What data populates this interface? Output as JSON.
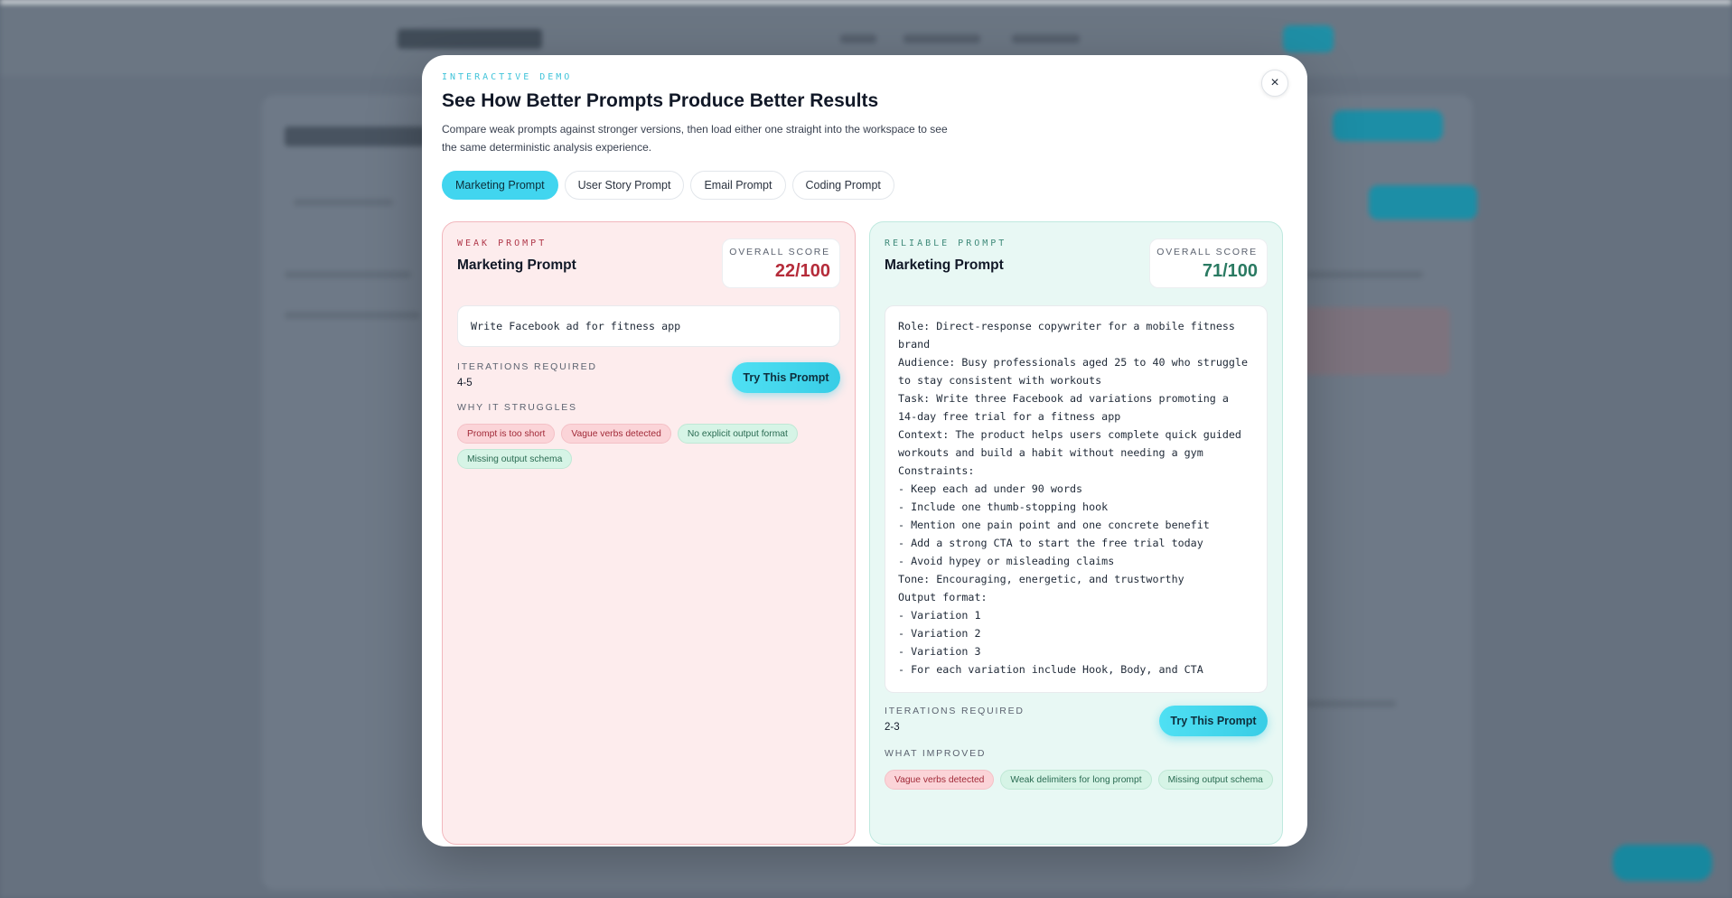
{
  "modal": {
    "eyebrow": "INTERACTIVE DEMO",
    "title": "See How Better Prompts Produce Better Results",
    "subtitle": "Compare weak prompts against stronger versions, then load either one straight into the workspace to see the same deterministic analysis experience.",
    "close_icon": "×"
  },
  "tabs": [
    {
      "label": "Marketing Prompt",
      "active": true
    },
    {
      "label": "User Story Prompt",
      "active": false
    },
    {
      "label": "Email Prompt",
      "active": false
    },
    {
      "label": "Coding Prompt",
      "active": false
    }
  ],
  "weak": {
    "eyebrow": "WEAK PROMPT",
    "title": "Marketing Prompt",
    "score_label": "OVERALL SCORE",
    "score": "22/100",
    "prompt": "Write Facebook ad for fitness app",
    "iterations_label": "ITERATIONS REQUIRED",
    "iterations": "4-5",
    "try_button": "Try This Prompt",
    "section_label": "WHY IT STRUGGLES",
    "chips": [
      {
        "text": "Prompt is too short",
        "tone": "negative"
      },
      {
        "text": "Vague verbs detected",
        "tone": "negative"
      },
      {
        "text": "No explicit output format",
        "tone": "positive"
      },
      {
        "text": "Missing output schema",
        "tone": "positive"
      }
    ]
  },
  "reliable": {
    "eyebrow": "RELIABLE PROMPT",
    "title": "Marketing Prompt",
    "score_label": "OVERALL SCORE",
    "score": "71/100",
    "prompt": "Role: Direct-response copywriter for a mobile fitness brand\nAudience: Busy professionals aged 25 to 40 who struggle to stay consistent with workouts\nTask: Write three Facebook ad variations promoting a 14-day free trial for a fitness app\nContext: The product helps users complete quick guided workouts and build a habit without needing a gym\nConstraints:\n- Keep each ad under 90 words\n- Include one thumb-stopping hook\n- Mention one pain point and one concrete benefit\n- Add a strong CTA to start the free trial today\n- Avoid hypey or misleading claims\nTone: Encouraging, energetic, and trustworthy\nOutput format:\n- Variation 1\n- Variation 2\n- Variation 3\n- For each variation include Hook, Body, and CTA",
    "iterations_label": "ITERATIONS REQUIRED",
    "iterations": "2-3",
    "try_button": "Try This Prompt",
    "section_label": "WHAT IMPROVED",
    "chips": [
      {
        "text": "Vague verbs detected",
        "tone": "negative"
      },
      {
        "text": "Weak delimiters for long prompt",
        "tone": "positive"
      },
      {
        "text": "Missing output schema",
        "tone": "positive"
      }
    ]
  }
}
